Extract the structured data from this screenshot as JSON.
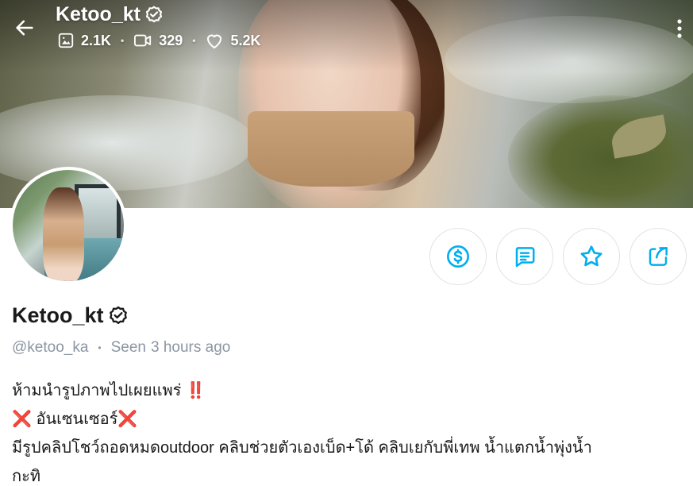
{
  "header": {
    "name": "Ketoo_kt",
    "stats": {
      "photos": "2.1K",
      "videos": "329",
      "likes": "5.2K"
    }
  },
  "profile": {
    "name": "Ketoo_kt",
    "handle": "@ketoo_ka",
    "seen_label": "Seen",
    "seen_time": "3 hours ago"
  },
  "bio": {
    "line1_text": "ห้ามนำรูปภาพไปเผยแพร่ ",
    "line1_emoji": "‼️",
    "line2_emoji_start": "❌",
    "line2_text": " อันเซนเซอร์",
    "line2_emoji_end": "❌",
    "line3": "มีรูปคลิปโชว์ถอดหมดoutdoor คลิบช่วยตัวเองเบ็ด+โด้ คลิบเยกับพี่เทพ น้ำแตกน้ำพุ่งน้ำ",
    "line4": "กะทิ"
  },
  "icons": {
    "back": "arrow-left-icon",
    "verified": "verified-badge-icon",
    "photos": "image-icon",
    "videos": "video-camera-icon",
    "likes": "heart-icon",
    "more": "more-vertical-icon",
    "tip": "dollar-circle-icon",
    "message": "message-icon",
    "favorite": "star-icon",
    "share": "share-icon"
  },
  "colors": {
    "accent": "#00aff0",
    "muted_text": "#8a96a3",
    "button_border": "#dfe3e8"
  }
}
